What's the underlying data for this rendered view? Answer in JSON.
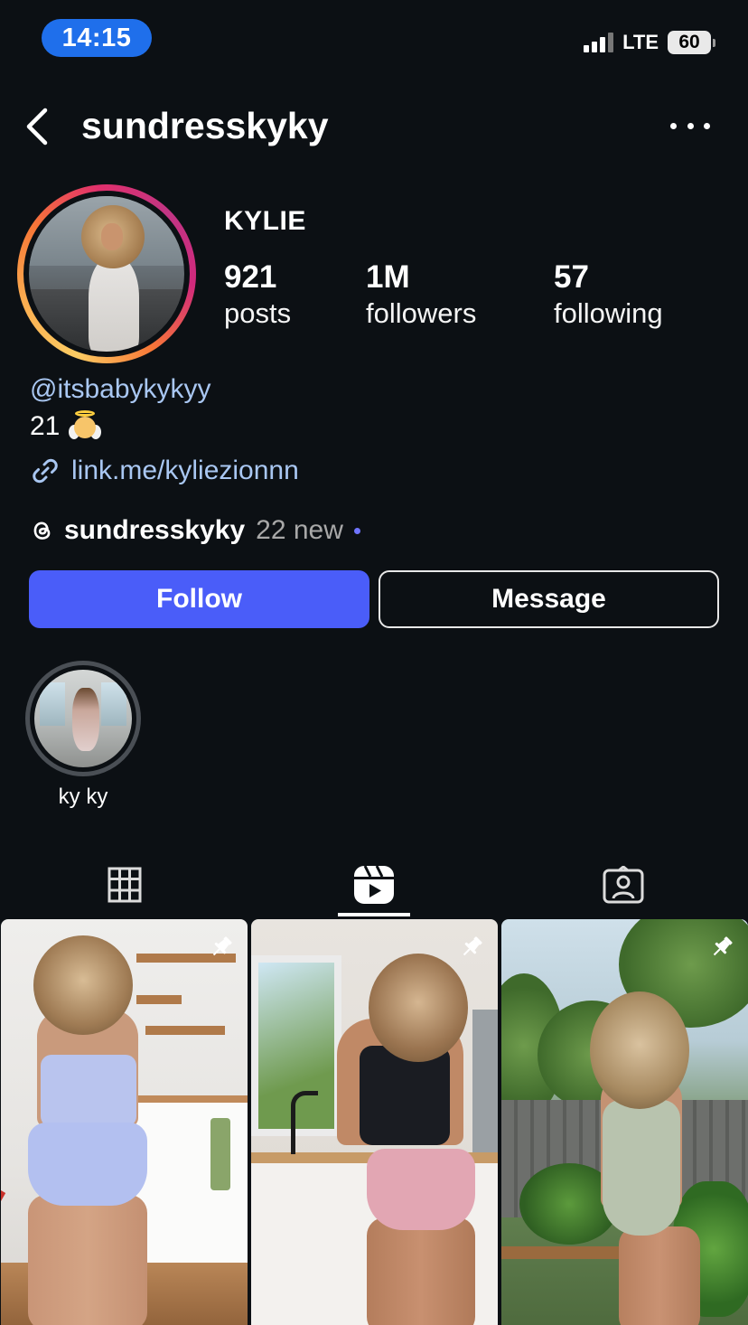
{
  "status_bar": {
    "time": "14:15",
    "network": "LTE",
    "battery": "60"
  },
  "header": {
    "username": "sundresskyky"
  },
  "profile": {
    "full_name": "KYLIE",
    "stats": {
      "posts_value": "921",
      "posts_label": "posts",
      "followers_value": "1M",
      "followers_label": "followers",
      "following_value": "57",
      "following_label": "following"
    },
    "bio": {
      "handle": "@itsbabykykyy",
      "age_line": "21",
      "link": "link.me/kyliezionnn"
    },
    "threads": {
      "name": "sundresskyky",
      "new_count": "22 new"
    }
  },
  "actions": {
    "follow_label": "Follow",
    "message_label": "Message"
  },
  "highlights": [
    {
      "label": "ky ky"
    }
  ],
  "tabs": [
    {
      "icon": "grid-icon",
      "active": false
    },
    {
      "icon": "reels-icon",
      "active": true
    },
    {
      "icon": "tagged-icon",
      "active": false
    }
  ],
  "posts": [
    {
      "pinned": true
    },
    {
      "pinned": true
    },
    {
      "pinned": true
    }
  ],
  "colors": {
    "background": "#0c1014",
    "follow_button": "#4a5df9",
    "link": "#a9c7f2",
    "time_pill": "#1f6feb"
  }
}
